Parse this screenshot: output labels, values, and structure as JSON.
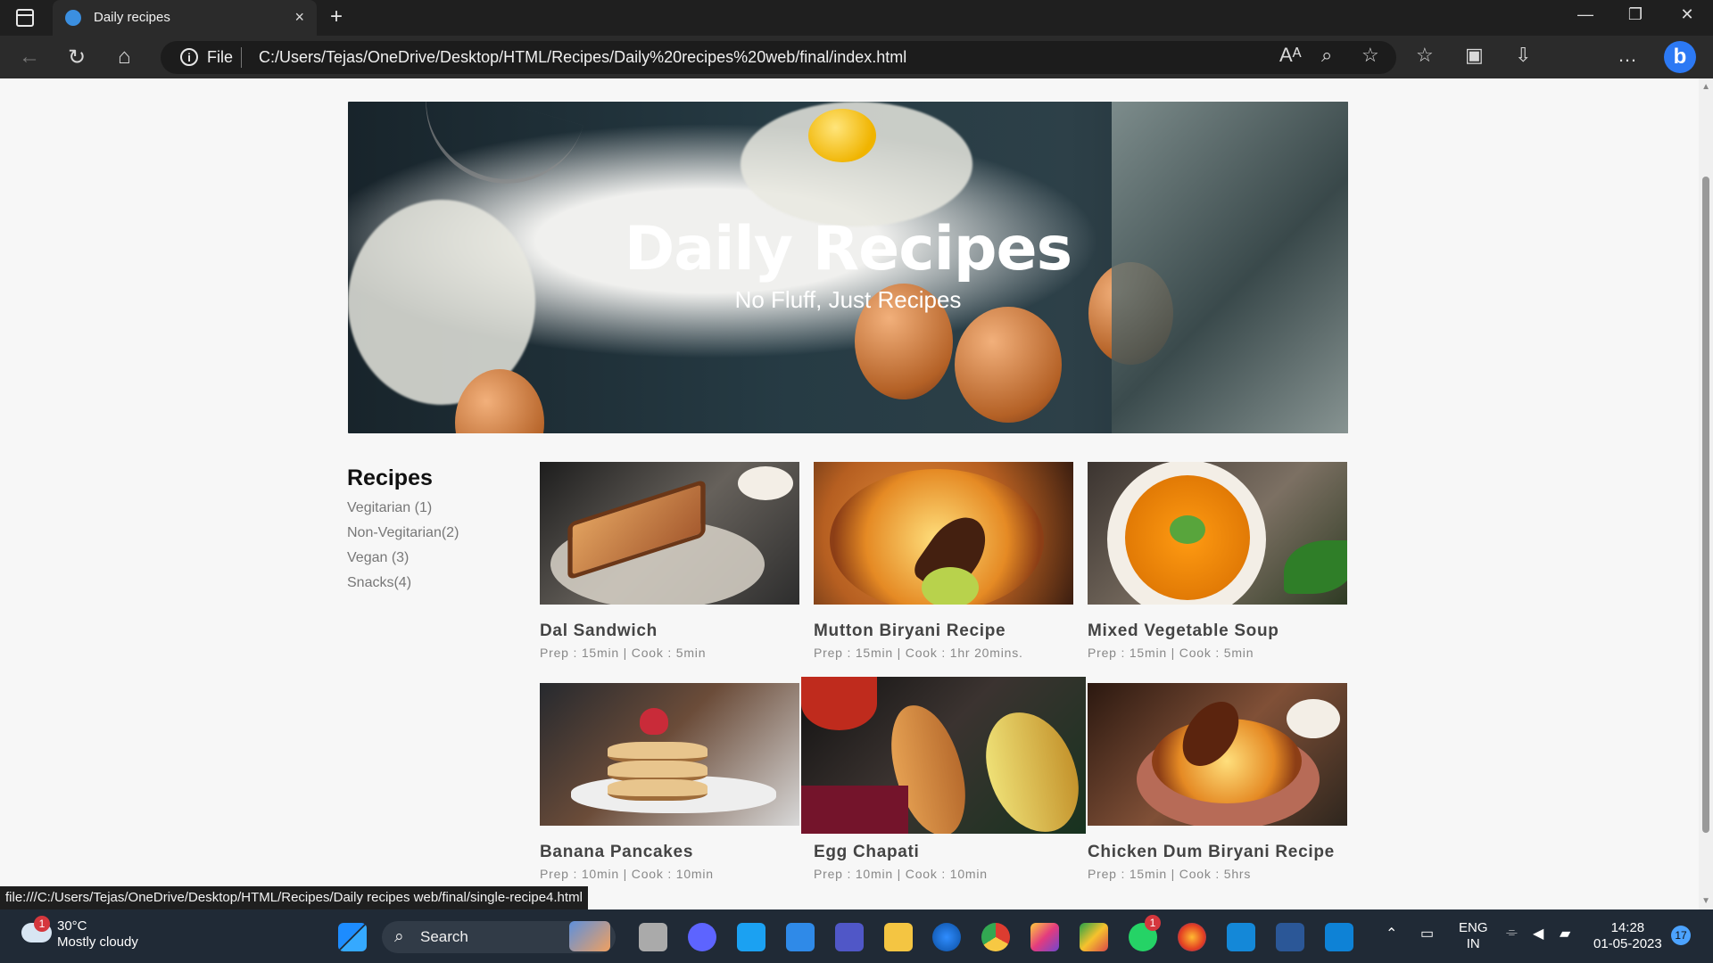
{
  "browser": {
    "tab_title": "Daily recipes",
    "close_tab": "×",
    "new_tab": "+",
    "url_prefix": "File",
    "url": "C:/Users/Tejas/OneDrive/Desktop/HTML/Recipes/Daily%20recipes%20web/final/index.html",
    "status_url": "file:///C:/Users/Tejas/OneDrive/Desktop/HTML/Recipes/Daily recipes web/final/single-recipe4.html"
  },
  "page": {
    "hero": {
      "title": "Daily Recipes",
      "subtitle": "No Fluff, Just Recipes"
    },
    "sidebar": {
      "title": "Recipes",
      "links": [
        {
          "label": "Vegitarian (1)"
        },
        {
          "label": "Non-Vegitarian(2)"
        },
        {
          "label": "Vegan (3)"
        },
        {
          "label": "Snacks(4)"
        }
      ]
    },
    "recipes": [
      {
        "title": "Dal Sandwich",
        "meta": "Prep : 15min | Cook : 5min"
      },
      {
        "title": "Mutton Biryani Recipe",
        "meta": "Prep : 15min | Cook : 1hr 20mins."
      },
      {
        "title": "Mixed Vegetable Soup",
        "meta": "Prep : 15min | Cook : 5min"
      },
      {
        "title": "Banana Pancakes",
        "meta": "Prep : 10min | Cook : 10min"
      },
      {
        "title": "Egg Chapati",
        "meta": "Prep : 10min | Cook : 10min"
      },
      {
        "title": "Chicken Dum Biryani Recipe",
        "meta": "Prep : 15min | Cook : 5hrs"
      }
    ]
  },
  "taskbar": {
    "weather": {
      "temperature": "30°C",
      "condition": "Mostly cloudy",
      "badge": "1"
    },
    "search_label": "Search",
    "whatsapp_badge": "1",
    "language": {
      "line1": "ENG",
      "line2": "IN"
    },
    "time": "14:28",
    "date": "01-05-2023",
    "notification_count": "17"
  },
  "colors": {
    "browser_dark": "#1f1f1f",
    "page_background": "#f7f7f7",
    "taskbar": "#202a36",
    "accent": "#2c79f4"
  }
}
